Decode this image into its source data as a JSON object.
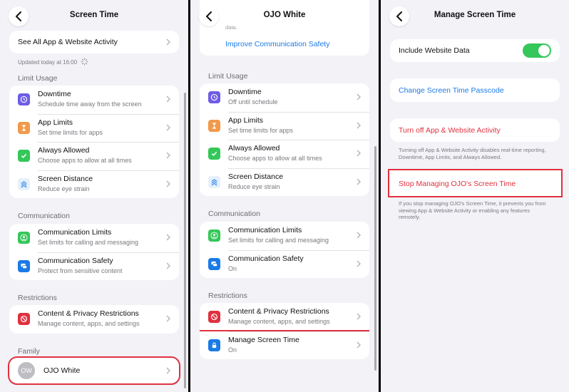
{
  "panel1": {
    "title": "Screen Time",
    "top_item": "See All App & Website Activity",
    "updated": "Updated today at 16:00",
    "limit_usage": {
      "header": "Limit Usage",
      "items": [
        {
          "title": "Downtime",
          "subtitle": "Schedule time away from the screen",
          "icon": "downtime-icon",
          "color": "#6e5ce6"
        },
        {
          "title": "App Limits",
          "subtitle": "Set time limits for apps",
          "icon": "hourglass-icon",
          "color": "#f2994a"
        },
        {
          "title": "Always Allowed",
          "subtitle": "Choose apps to allow at all times",
          "icon": "checkmark-icon",
          "color": "#34c759"
        },
        {
          "title": "Screen Distance",
          "subtitle": "Reduce eye strain",
          "icon": "screen-distance-icon",
          "color": "#e6f0fb"
        }
      ]
    },
    "communication": {
      "header": "Communication",
      "items": [
        {
          "title": "Communication Limits",
          "subtitle": "Set limits for calling and messaging",
          "icon": "person-icon",
          "color": "#34c759"
        },
        {
          "title": "Communication Safety",
          "subtitle": "Protect from sensitive content",
          "icon": "speech-bubble-icon",
          "color": "#1a7ae6"
        }
      ]
    },
    "restrictions": {
      "header": "Restrictions",
      "items": [
        {
          "title": "Content & Privacy Restrictions",
          "subtitle": "Manage content, apps, and settings",
          "icon": "no-entry-icon",
          "color": "#e0313f"
        }
      ]
    },
    "family": {
      "header": "Family",
      "member_initials": "OW",
      "member_name": "OJO White"
    }
  },
  "panel2": {
    "title": "OJO White",
    "partial_text": "data.",
    "improve_link": "Improve Communication Safety",
    "limit_usage": {
      "header": "Limit Usage",
      "items": [
        {
          "title": "Downtime",
          "subtitle": "Off until schedule"
        },
        {
          "title": "App Limits",
          "subtitle": "Set time limits for apps"
        },
        {
          "title": "Always Allowed",
          "subtitle": "Choose apps to allow at all times"
        },
        {
          "title": "Screen Distance",
          "subtitle": "Reduce eye strain"
        }
      ]
    },
    "communication": {
      "header": "Communication",
      "items": [
        {
          "title": "Communication Limits",
          "subtitle": "Set limits for calling and messaging"
        },
        {
          "title": "Communication Safety",
          "subtitle": "On"
        }
      ]
    },
    "restrictions": {
      "header": "Restrictions",
      "items": [
        {
          "title": "Content & Privacy Restrictions",
          "subtitle": "Manage content, apps, and settings"
        },
        {
          "title": "Manage Screen Time",
          "subtitle": "On",
          "icon": "lock-icon",
          "color": "#1a7ae6"
        }
      ]
    }
  },
  "panel3": {
    "title": "Manage Screen Time",
    "include_website_data": "Include Website Data",
    "include_website_data_on": true,
    "change_passcode": "Change Screen Time Passcode",
    "turn_off": "Turn off App & Website Activity",
    "turn_off_note": "Turning off App & Website Activity disables real-time reporting, Downtime, App Limits, and Always Allowed.",
    "stop_managing": "Stop Managing OJO's Screen Time",
    "stop_note": "If you stop managing OJO's Screen Time, it prevents you from viewing App & Website Activity or enabling any features remotely."
  },
  "colors": {
    "accent_blue": "#1a7ae6",
    "destructive_red": "#e0313f",
    "toggle_green": "#34c759",
    "highlight_red": "#e0313f"
  }
}
